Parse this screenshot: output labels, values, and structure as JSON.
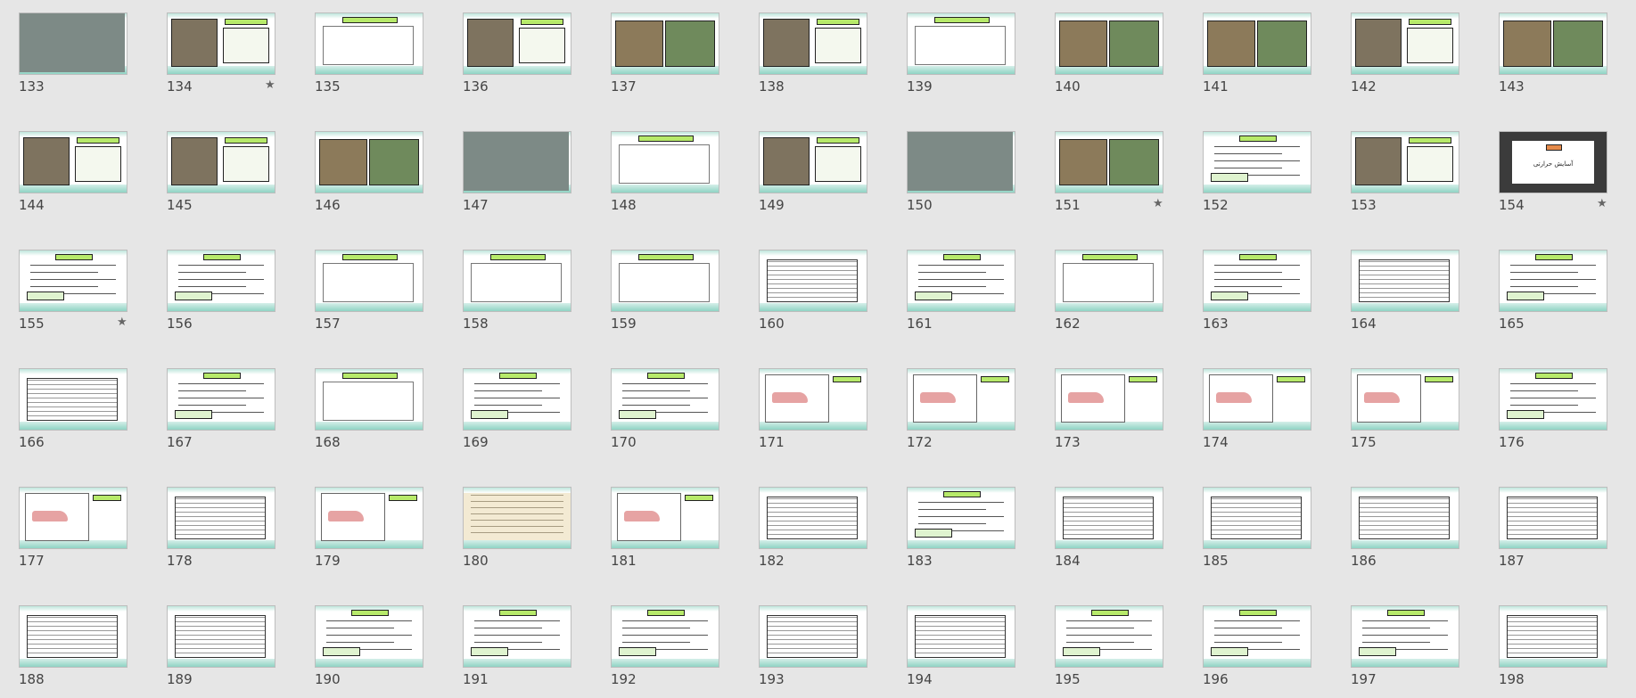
{
  "slides": [
    {
      "number": "133",
      "star": false,
      "kind": "photo"
    },
    {
      "number": "134",
      "star": true,
      "kind": "mixed"
    },
    {
      "number": "135",
      "star": false,
      "kind": "diagram"
    },
    {
      "number": "136",
      "star": false,
      "kind": "mixed"
    },
    {
      "number": "137",
      "star": false,
      "kind": "photos"
    },
    {
      "number": "138",
      "star": false,
      "kind": "mixed"
    },
    {
      "number": "139",
      "star": false,
      "kind": "diagram"
    },
    {
      "number": "140",
      "star": false,
      "kind": "photos"
    },
    {
      "number": "141",
      "star": false,
      "kind": "photos"
    },
    {
      "number": "142",
      "star": false,
      "kind": "mixed"
    },
    {
      "number": "143",
      "star": false,
      "kind": "photos"
    },
    {
      "number": "144",
      "star": false,
      "kind": "mixed"
    },
    {
      "number": "145",
      "star": false,
      "kind": "mixed"
    },
    {
      "number": "146",
      "star": false,
      "kind": "photos"
    },
    {
      "number": "147",
      "star": false,
      "kind": "photo"
    },
    {
      "number": "148",
      "star": false,
      "kind": "diagram"
    },
    {
      "number": "149",
      "star": false,
      "kind": "mixed"
    },
    {
      "number": "150",
      "star": false,
      "kind": "photo"
    },
    {
      "number": "151",
      "star": true,
      "kind": "photos"
    },
    {
      "number": "152",
      "star": false,
      "kind": "text"
    },
    {
      "number": "153",
      "star": false,
      "kind": "mixed"
    },
    {
      "number": "154",
      "star": true,
      "kind": "title"
    },
    {
      "number": "155",
      "star": true,
      "kind": "text"
    },
    {
      "number": "156",
      "star": false,
      "kind": "text"
    },
    {
      "number": "157",
      "star": false,
      "kind": "diagram"
    },
    {
      "number": "158",
      "star": false,
      "kind": "diagram"
    },
    {
      "number": "159",
      "star": false,
      "kind": "diagram"
    },
    {
      "number": "160",
      "star": false,
      "kind": "table"
    },
    {
      "number": "161",
      "star": false,
      "kind": "text"
    },
    {
      "number": "162",
      "star": false,
      "kind": "diagram"
    },
    {
      "number": "163",
      "star": false,
      "kind": "text"
    },
    {
      "number": "164",
      "star": false,
      "kind": "table"
    },
    {
      "number": "165",
      "star": false,
      "kind": "text"
    },
    {
      "number": "166",
      "star": false,
      "kind": "table"
    },
    {
      "number": "167",
      "star": false,
      "kind": "text"
    },
    {
      "number": "168",
      "star": false,
      "kind": "diagram"
    },
    {
      "number": "169",
      "star": false,
      "kind": "text"
    },
    {
      "number": "170",
      "star": false,
      "kind": "text"
    },
    {
      "number": "171",
      "star": false,
      "kind": "chart"
    },
    {
      "number": "172",
      "star": false,
      "kind": "chart"
    },
    {
      "number": "173",
      "star": false,
      "kind": "chart"
    },
    {
      "number": "174",
      "star": false,
      "kind": "chart"
    },
    {
      "number": "175",
      "star": false,
      "kind": "chart"
    },
    {
      "number": "176",
      "star": false,
      "kind": "text"
    },
    {
      "number": "177",
      "star": false,
      "kind": "chart"
    },
    {
      "number": "178",
      "star": false,
      "kind": "table"
    },
    {
      "number": "179",
      "star": false,
      "kind": "chart"
    },
    {
      "number": "180",
      "star": false,
      "kind": "document"
    },
    {
      "number": "181",
      "star": false,
      "kind": "chart"
    },
    {
      "number": "182",
      "star": false,
      "kind": "table"
    },
    {
      "number": "183",
      "star": false,
      "kind": "text"
    },
    {
      "number": "184",
      "star": false,
      "kind": "table"
    },
    {
      "number": "185",
      "star": false,
      "kind": "table"
    },
    {
      "number": "186",
      "star": false,
      "kind": "table"
    },
    {
      "number": "187",
      "star": false,
      "kind": "table"
    },
    {
      "number": "188",
      "star": false,
      "kind": "table"
    },
    {
      "number": "189",
      "star": false,
      "kind": "table"
    },
    {
      "number": "190",
      "star": false,
      "kind": "text"
    },
    {
      "number": "191",
      "star": false,
      "kind": "text"
    },
    {
      "number": "192",
      "star": false,
      "kind": "text"
    },
    {
      "number": "193",
      "star": false,
      "kind": "table"
    },
    {
      "number": "194",
      "star": false,
      "kind": "table"
    },
    {
      "number": "195",
      "star": false,
      "kind": "text"
    },
    {
      "number": "196",
      "star": false,
      "kind": "text"
    },
    {
      "number": "197",
      "star": false,
      "kind": "text"
    },
    {
      "number": "198",
      "star": false,
      "kind": "table"
    }
  ],
  "star_glyph": "★",
  "title_slide_text": "آسایش حرارتی",
  "colors": {
    "background": "#e6e6e6",
    "header_green": "#b7ea6a",
    "band_teal": "#8fd3c4"
  }
}
